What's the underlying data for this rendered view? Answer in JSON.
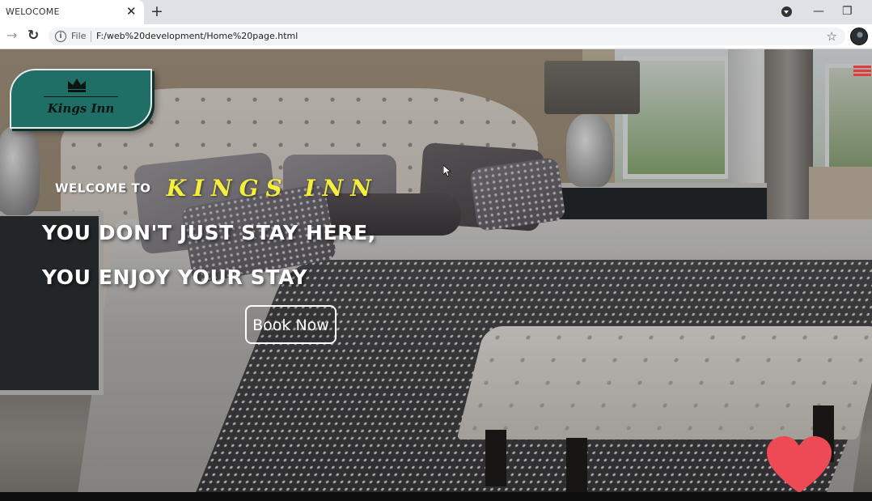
{
  "browser": {
    "tab_title": "WELOCOME",
    "tab_close": "✕",
    "new_tab": "+",
    "minimize": "—",
    "restore": "❐",
    "close": "✕",
    "file_label": "File",
    "url": "F:/web%20development/Home%20page.html",
    "bookmark_icon": "☆",
    "back_icon": "→",
    "reload_icon": "↻"
  },
  "logo": {
    "text": "Kings Inn"
  },
  "hero": {
    "welcome_to": "WELCOME TO",
    "brand": "KINGS INN",
    "tagline_1": "YOU DON'T JUST STAY HERE,",
    "tagline_2": "YOU ENJOY YOUR STAY",
    "book_button": "Book Now"
  },
  "colors": {
    "brand_yellow": "#f5ee3c",
    "logo_teal": "#1f6f66",
    "menu_red": "#e23b3b",
    "heart_red": "#ee4a55"
  },
  "icons": [
    "info-icon",
    "star-icon",
    "menu-icon",
    "heart-icon",
    "crown-icon",
    "avatar-icon",
    "cursor-icon"
  ]
}
